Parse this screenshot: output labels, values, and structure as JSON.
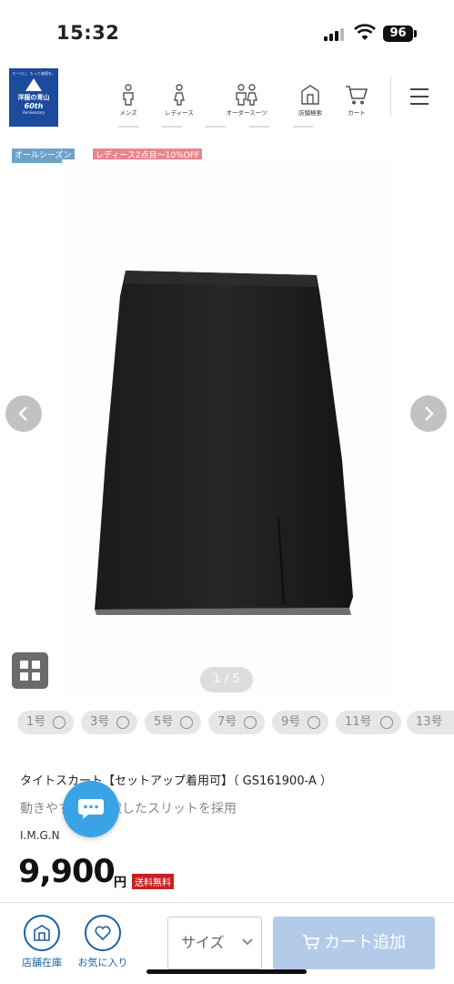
{
  "status_bar": {
    "time": "15:32",
    "battery": "96"
  },
  "header": {
    "logo": {
      "tagline": "スーツに、もっと価値を。",
      "brand": "洋服の青山",
      "years": "60th",
      "anniversary": "Anniversary"
    },
    "nav": [
      {
        "label": "メンズ",
        "icon": "man-icon"
      },
      {
        "label": "レディース",
        "icon": "woman-icon"
      },
      {
        "label": "オーダースーツ",
        "icon": "couple-icon"
      },
      {
        "label": "店舗検索",
        "icon": "store-icon"
      },
      {
        "label": "カート",
        "icon": "cart-icon"
      }
    ]
  },
  "badges": {
    "season": "オールシーズン",
    "promo": "レディース2点目～10%OFF"
  },
  "gallery": {
    "counter": "1 / 5"
  },
  "sizes": [
    "1号",
    "3号",
    "5号",
    "7号",
    "9号",
    "11号",
    "13号"
  ],
  "product": {
    "name": "タイトスカート【セットアップ着用可】（ GS161900-A ）",
    "description": "動きやすさに配慮したスリットを採用",
    "brand": "I.M.G.N",
    "price": "9,900",
    "currency": "円",
    "shipping": "送料無料"
  },
  "bottom_bar": {
    "store_stock": "店舗在庫",
    "favorite": "お気に入り",
    "size_select": "サイズ",
    "add_to_cart": "カート追加"
  },
  "colors": {
    "brand_blue": "#1c4a9c",
    "accent_blue": "#1d5fa6",
    "cart_button": "#b3cbe8",
    "chat": "#3aa3e6",
    "sale_red": "#c91f1f"
  }
}
